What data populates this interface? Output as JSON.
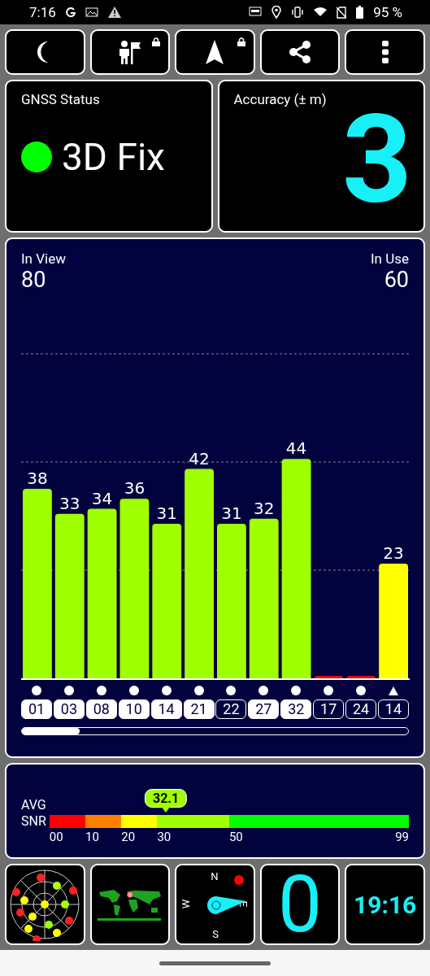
{
  "status_bar": {
    "time": "7:16",
    "battery": "95 %"
  },
  "toolbar": [
    {
      "kind": "moon",
      "locked": false
    },
    {
      "kind": "person",
      "locked": true
    },
    {
      "kind": "arrow",
      "locked": true
    },
    {
      "kind": "share",
      "locked": false
    },
    {
      "kind": "more",
      "locked": false
    }
  ],
  "gnss_status": {
    "title": "GNSS Status",
    "color": "#00ff00",
    "value": "3D Fix"
  },
  "accuracy": {
    "title": "Accuracy (± m)",
    "value": "3"
  },
  "satellites_panel": {
    "in_view_label": "In View",
    "in_view": "80",
    "in_use_label": "In Use",
    "in_use": "60",
    "satellites": [
      {
        "signal": "38",
        "color": "#a0ff00",
        "kind": "dot",
        "number": "01",
        "used": true
      },
      {
        "signal": "33",
        "color": "#a0ff00",
        "kind": "dot",
        "number": "03",
        "used": true
      },
      {
        "signal": "34",
        "color": "#a0ff00",
        "kind": "dot",
        "number": "08",
        "used": true
      },
      {
        "signal": "36",
        "color": "#a0ff00",
        "kind": "dot",
        "number": "10",
        "used": true
      },
      {
        "signal": "31",
        "color": "#a0ff00",
        "kind": "dot",
        "number": "14",
        "used": true
      },
      {
        "signal": "42",
        "color": "#a0ff00",
        "kind": "dot",
        "number": "21",
        "used": true
      },
      {
        "signal": "31",
        "color": "#a0ff00",
        "kind": "dot",
        "number": "22",
        "used": false
      },
      {
        "signal": "32",
        "color": "#a0ff00",
        "kind": "dot",
        "number": "27",
        "used": true
      },
      {
        "signal": "44",
        "color": "#a0ff00",
        "kind": "dot",
        "number": "32",
        "used": true
      },
      {
        "color": "#ff0000",
        "kind": "dot",
        "number": "17",
        "used": false
      },
      {
        "color": "#ff0000",
        "kind": "dot",
        "number": "24",
        "used": false
      },
      {
        "signal": "23",
        "color": "#ffff00",
        "kind": "triangle",
        "number": "14",
        "used": false
      }
    ]
  },
  "snr": {
    "label_1": "AVG",
    "label_2": "SNR",
    "value": "32.1",
    "segments": [
      {
        "color": "#ff0000"
      },
      {
        "color": "#ff8000"
      },
      {
        "color": "#ffff00"
      },
      {
        "color": "#a0ff00"
      },
      {
        "color": "#00ff00"
      }
    ],
    "ticks": [
      "00",
      "10",
      "20",
      "30",
      "50",
      "99"
    ]
  },
  "tiles": [
    {
      "kind": "radar"
    },
    {
      "kind": "map"
    },
    {
      "kind": "compass",
      "north": "N",
      "west": "W",
      "east": "E",
      "south": "S"
    },
    {
      "kind": "big",
      "value": "0"
    },
    {
      "kind": "clock",
      "value": "19:16"
    }
  ]
}
